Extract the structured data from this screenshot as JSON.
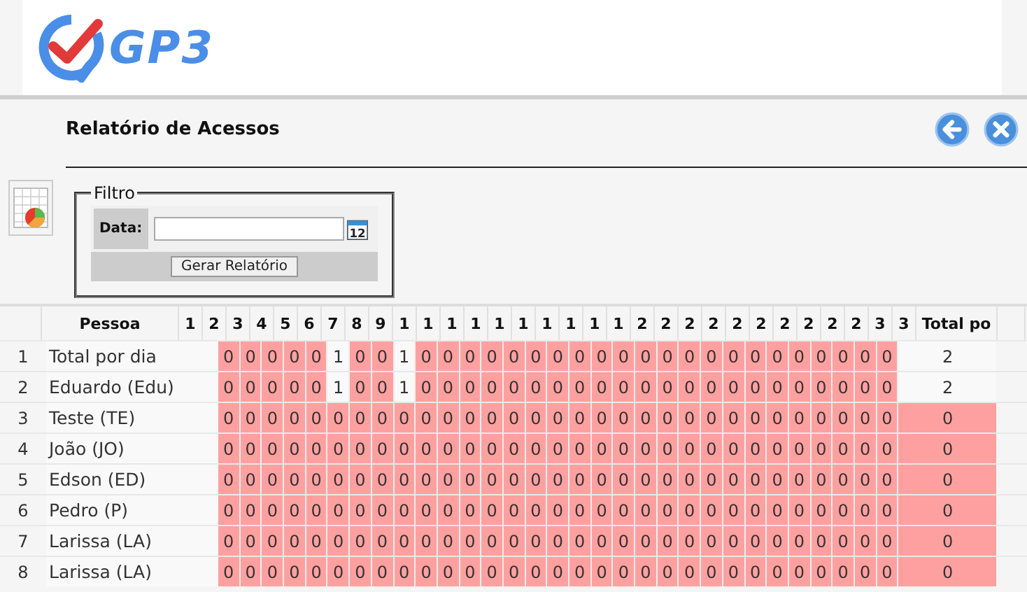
{
  "header": {
    "logo_text": "GP3"
  },
  "page": {
    "title": "Relatório de Acessos"
  },
  "filter": {
    "legend": "Filtro",
    "date_label": "Data:",
    "calendar_day": "12",
    "button": "Gerar Relatório"
  },
  "table": {
    "columns": [
      "Pessoa",
      "1",
      "2",
      "3",
      "4",
      "5",
      "6",
      "7",
      "8",
      "9",
      "1",
      "1",
      "1",
      "1",
      "1",
      "1",
      "1",
      "1",
      "1",
      "1",
      "2",
      "2",
      "2",
      "2",
      "2",
      "2",
      "2",
      "2",
      "2",
      "2",
      "3",
      "3",
      "Total po"
    ],
    "rows": [
      {
        "number": "1",
        "name": "Total por dia",
        "values": [
          "0",
          "0",
          "0",
          "0",
          "0",
          "1",
          "0",
          "0",
          "1",
          "0",
          "0",
          "0",
          "0",
          "0",
          "0",
          "0",
          "0",
          "0",
          "0",
          "0",
          "0",
          "0",
          "0",
          "0",
          "0",
          "0",
          "0",
          "0",
          "0",
          "0",
          "0"
        ],
        "highlighted": [
          true,
          true,
          true,
          true,
          true,
          false,
          true,
          true,
          false,
          true,
          true,
          true,
          true,
          true,
          true,
          true,
          true,
          true,
          true,
          true,
          true,
          true,
          true,
          true,
          true,
          true,
          true,
          true,
          true,
          true,
          true
        ],
        "total": "2",
        "total_highlighted": false
      },
      {
        "number": "2",
        "name": "Eduardo (Edu)",
        "values": [
          "0",
          "0",
          "0",
          "0",
          "0",
          "1",
          "0",
          "0",
          "1",
          "0",
          "0",
          "0",
          "0",
          "0",
          "0",
          "0",
          "0",
          "0",
          "0",
          "0",
          "0",
          "0",
          "0",
          "0",
          "0",
          "0",
          "0",
          "0",
          "0",
          "0",
          "0"
        ],
        "highlighted": [
          true,
          true,
          true,
          true,
          true,
          false,
          true,
          true,
          false,
          true,
          true,
          true,
          true,
          true,
          true,
          true,
          true,
          true,
          true,
          true,
          true,
          true,
          true,
          true,
          true,
          true,
          true,
          true,
          true,
          true,
          true
        ],
        "total": "2",
        "total_highlighted": false
      },
      {
        "number": "3",
        "name": "Teste (TE)",
        "values": [
          "0",
          "0",
          "0",
          "0",
          "0",
          "0",
          "0",
          "0",
          "0",
          "0",
          "0",
          "0",
          "0",
          "0",
          "0",
          "0",
          "0",
          "0",
          "0",
          "0",
          "0",
          "0",
          "0",
          "0",
          "0",
          "0",
          "0",
          "0",
          "0",
          "0",
          "0"
        ],
        "highlighted": [
          true,
          true,
          true,
          true,
          true,
          true,
          true,
          true,
          true,
          true,
          true,
          true,
          true,
          true,
          true,
          true,
          true,
          true,
          true,
          true,
          true,
          true,
          true,
          true,
          true,
          true,
          true,
          true,
          true,
          true,
          true
        ],
        "total": "0",
        "total_highlighted": true
      },
      {
        "number": "4",
        "name": "João (JO)",
        "values": [
          "0",
          "0",
          "0",
          "0",
          "0",
          "0",
          "0",
          "0",
          "0",
          "0",
          "0",
          "0",
          "0",
          "0",
          "0",
          "0",
          "0",
          "0",
          "0",
          "0",
          "0",
          "0",
          "0",
          "0",
          "0",
          "0",
          "0",
          "0",
          "0",
          "0",
          "0"
        ],
        "highlighted": [
          true,
          true,
          true,
          true,
          true,
          true,
          true,
          true,
          true,
          true,
          true,
          true,
          true,
          true,
          true,
          true,
          true,
          true,
          true,
          true,
          true,
          true,
          true,
          true,
          true,
          true,
          true,
          true,
          true,
          true,
          true
        ],
        "total": "0",
        "total_highlighted": true
      },
      {
        "number": "5",
        "name": "Edson (ED)",
        "values": [
          "0",
          "0",
          "0",
          "0",
          "0",
          "0",
          "0",
          "0",
          "0",
          "0",
          "0",
          "0",
          "0",
          "0",
          "0",
          "0",
          "0",
          "0",
          "0",
          "0",
          "0",
          "0",
          "0",
          "0",
          "0",
          "0",
          "0",
          "0",
          "0",
          "0",
          "0"
        ],
        "highlighted": [
          true,
          true,
          true,
          true,
          true,
          true,
          true,
          true,
          true,
          true,
          true,
          true,
          true,
          true,
          true,
          true,
          true,
          true,
          true,
          true,
          true,
          true,
          true,
          true,
          true,
          true,
          true,
          true,
          true,
          true,
          true
        ],
        "total": "0",
        "total_highlighted": true
      },
      {
        "number": "6",
        "name": "Pedro (P)",
        "values": [
          "0",
          "0",
          "0",
          "0",
          "0",
          "0",
          "0",
          "0",
          "0",
          "0",
          "0",
          "0",
          "0",
          "0",
          "0",
          "0",
          "0",
          "0",
          "0",
          "0",
          "0",
          "0",
          "0",
          "0",
          "0",
          "0",
          "0",
          "0",
          "0",
          "0",
          "0"
        ],
        "highlighted": [
          true,
          true,
          true,
          true,
          true,
          true,
          true,
          true,
          true,
          true,
          true,
          true,
          true,
          true,
          true,
          true,
          true,
          true,
          true,
          true,
          true,
          true,
          true,
          true,
          true,
          true,
          true,
          true,
          true,
          true,
          true
        ],
        "total": "0",
        "total_highlighted": true
      },
      {
        "number": "7",
        "name": "Larissa (LA)",
        "values": [
          "0",
          "0",
          "0",
          "0",
          "0",
          "0",
          "0",
          "0",
          "0",
          "0",
          "0",
          "0",
          "0",
          "0",
          "0",
          "0",
          "0",
          "0",
          "0",
          "0",
          "0",
          "0",
          "0",
          "0",
          "0",
          "0",
          "0",
          "0",
          "0",
          "0",
          "0"
        ],
        "highlighted": [
          true,
          true,
          true,
          true,
          true,
          true,
          true,
          true,
          true,
          true,
          true,
          true,
          true,
          true,
          true,
          true,
          true,
          true,
          true,
          true,
          true,
          true,
          true,
          true,
          true,
          true,
          true,
          true,
          true,
          true,
          true
        ],
        "total": "0",
        "total_highlighted": true
      },
      {
        "number": "8",
        "name": "Larissa (LA)",
        "values": [
          "0",
          "0",
          "0",
          "0",
          "0",
          "0",
          "0",
          "0",
          "0",
          "0",
          "0",
          "0",
          "0",
          "0",
          "0",
          "0",
          "0",
          "0",
          "0",
          "0",
          "0",
          "0",
          "0",
          "0",
          "0",
          "0",
          "0",
          "0",
          "0",
          "0",
          "0"
        ],
        "highlighted": [
          true,
          true,
          true,
          true,
          true,
          true,
          true,
          true,
          true,
          true,
          true,
          true,
          true,
          true,
          true,
          true,
          true,
          true,
          true,
          true,
          true,
          true,
          true,
          true,
          true,
          true,
          true,
          true,
          true,
          true,
          true
        ],
        "total": "0",
        "total_highlighted": true
      }
    ]
  }
}
